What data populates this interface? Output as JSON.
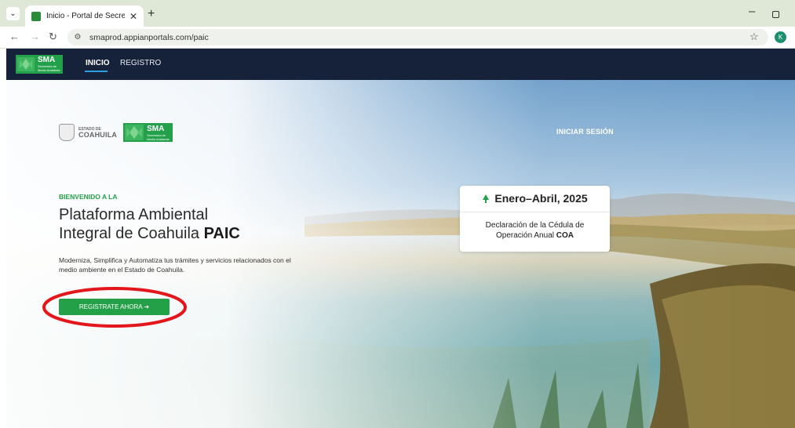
{
  "browser": {
    "tab_title": "Inicio - Portal de Secretaría de",
    "url": "smaprod.appianportals.com/paic",
    "profile_initial": "K"
  },
  "navbar": {
    "logo_text": "SMA",
    "logo_subtitle": "Secretaría de Medio Ambiente",
    "links": [
      {
        "label": "INICIO",
        "active": true
      },
      {
        "label": "REGISTRO",
        "active": false
      }
    ]
  },
  "hero": {
    "estado_small": "ESTADO DE",
    "estado_big": "COAHUILA",
    "sma_logo_text": "SMA",
    "sma_logo_subtitle": "Secretaría de Medio Ambiente",
    "login_label": "INICIAR SESIÓN",
    "welcome": "BIENVENIDO A LA",
    "headline_line1": "Plataforma Ambiental",
    "headline_line2": "Integral de Coahuila",
    "headline_bold": "PAIC",
    "description": "Moderniza, Simplifica y Automatiza tus trámites y servicios relacionados con el medio ambiente en el Estado de Coahuila.",
    "cta_label": "REGISTRATE AHORA ➔"
  },
  "info_card": {
    "title": "Enero–Abril, 2025",
    "text_line1": "Declaración de la Cédula de",
    "text_line2": "Operación Anual",
    "text_bold": "COA",
    "icon": "tree-icon"
  },
  "colors": {
    "brand_green": "#23a048",
    "navbar_bg": "#16213a",
    "annotation_red": "#e3161b"
  }
}
